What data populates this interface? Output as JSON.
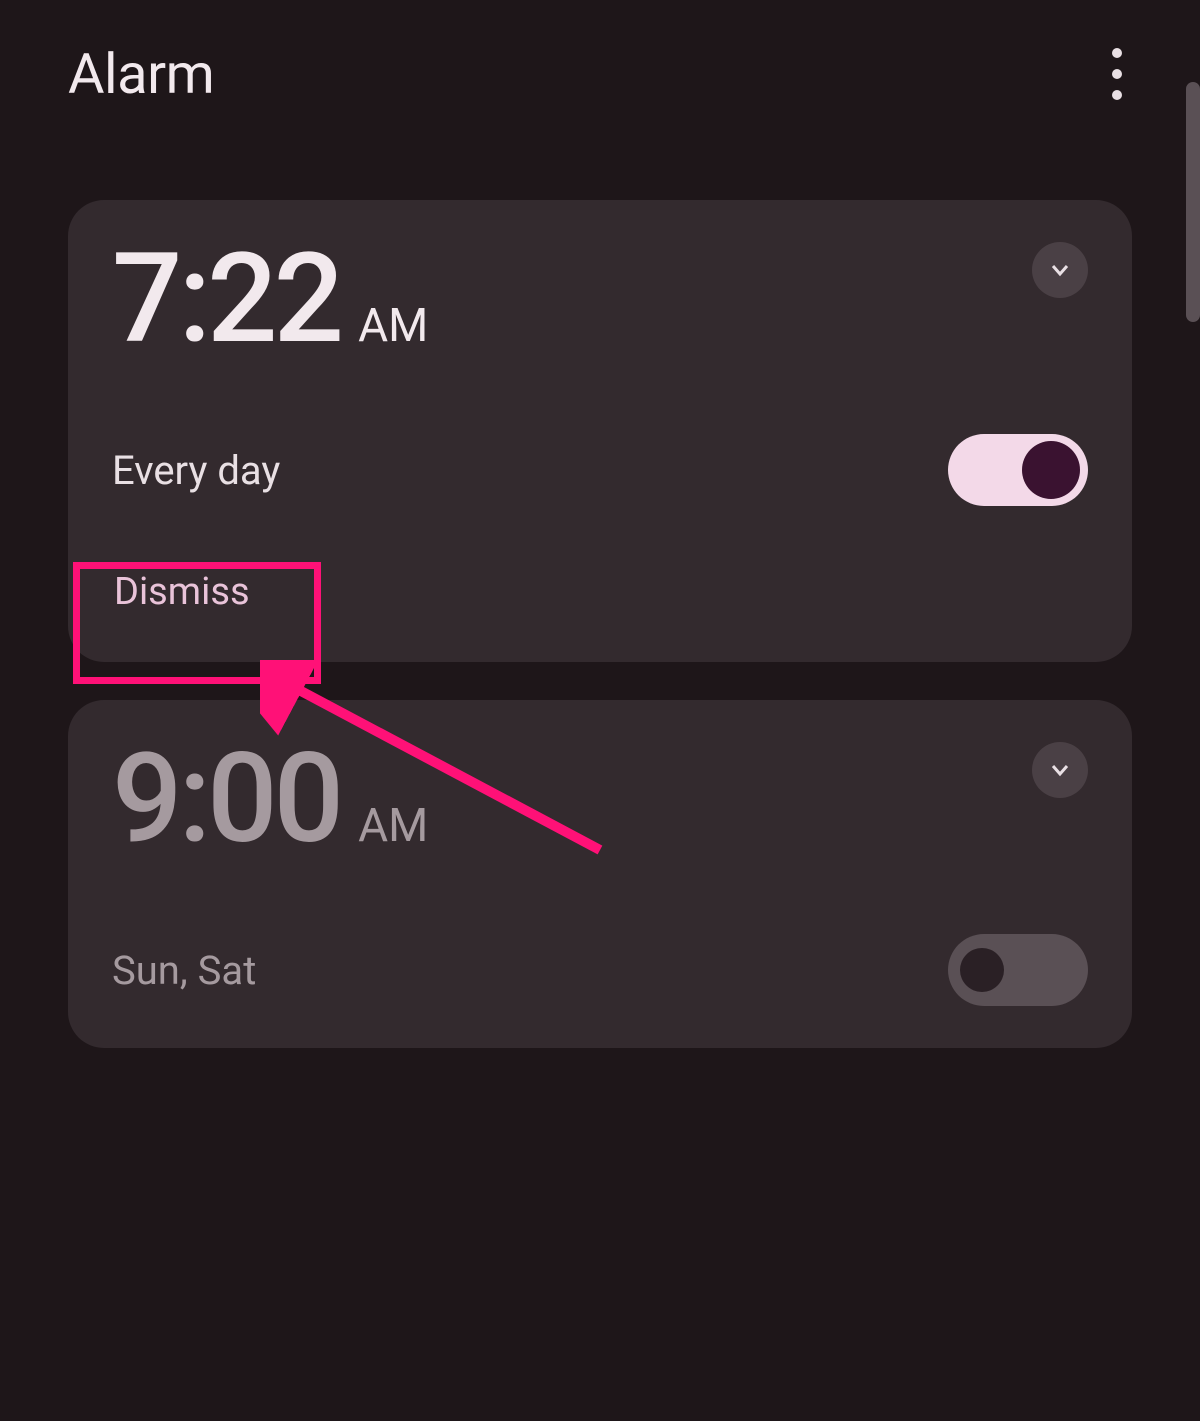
{
  "header": {
    "title": "Alarm"
  },
  "alarms": [
    {
      "time": "7:22",
      "period": "AM",
      "schedule": "Every day",
      "enabled": true,
      "dismiss_label": "Dismiss"
    },
    {
      "time": "9:00",
      "period": "AM",
      "schedule": "Sun, Sat",
      "enabled": false
    }
  ],
  "annotation": {
    "highlight_color": "#ff1177"
  }
}
